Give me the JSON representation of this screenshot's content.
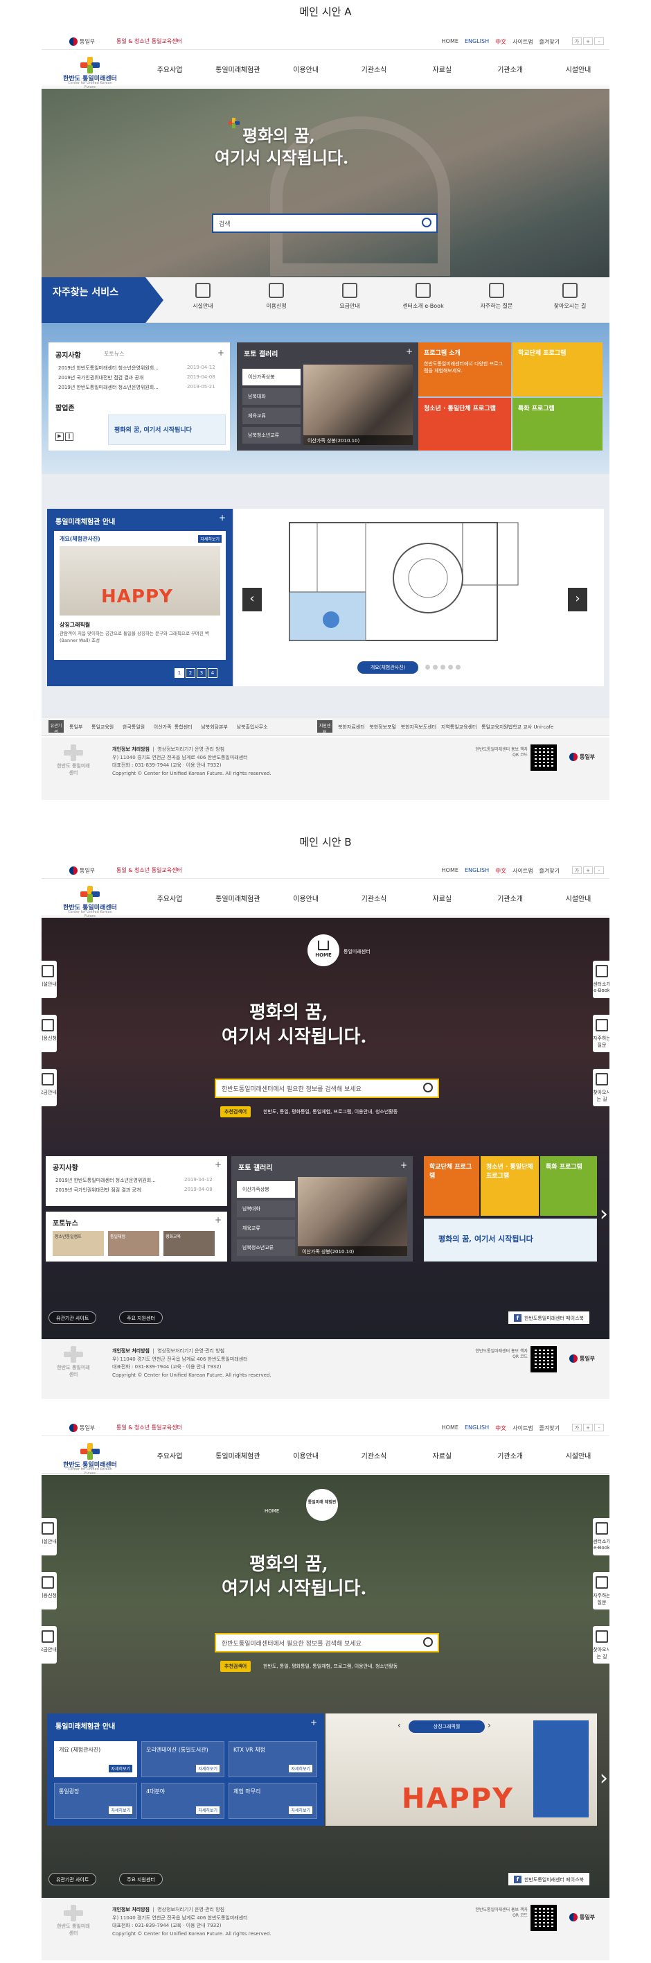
{
  "section_titles": {
    "a": "메인 시안 A",
    "b": "메인 시안 B"
  },
  "topbar": {
    "gov_label": "통일부",
    "partner_label": "통일 & 청소년 통일교육센터",
    "util": [
      "HOME",
      "ENGLISH",
      "中文",
      "사이트맵",
      "즐겨찾기"
    ],
    "font_sizes": [
      "가",
      "+",
      "-"
    ]
  },
  "logo": {
    "title": "한반도 통일미래센터",
    "subtitle": "Center for Unified Korean Future"
  },
  "menu": [
    "주요사업",
    "통일미래체험관",
    "이용안내",
    "기관소식",
    "자료실",
    "기관소개",
    "시설안내"
  ],
  "hero": {
    "slogan_line1": "평화의 꿈,",
    "slogan_line2": "여기서 시작됩니다.",
    "search_placeholder_a": "검색",
    "search_placeholder_b": "한반도통일미래센터에서 필요한 정보를 검색해 보세요",
    "recommend_label": "추천검색어",
    "recommend_terms": "한반도, 통일, 평화통일, 통일체험, 프로그램, 이용안내, 청소년활동"
  },
  "quick": {
    "title": "자주찾는 서비스",
    "items": [
      "시설안내",
      "이용신청",
      "요금안내",
      "센터소개 e-Book",
      "자주하는 질문",
      "찾아오시는 길"
    ]
  },
  "notice": {
    "tabs": [
      "공지사항",
      "포토뉴스"
    ],
    "items": [
      {
        "text": "2019년 한반도통일미래센터 청소년운영위원회...",
        "date": "2019-04-12"
      },
      {
        "text": "2019년 국가인권위대전만 점검 결과 공개",
        "date": "2019-04-08"
      },
      {
        "text": "2019년 한반도통일미래센터 청소년운영위원회...",
        "date": "2019-05-21"
      }
    ],
    "items_b": [
      {
        "text": "2019년 한반도통일미래센터 청소년운영위원회...",
        "date": "2019-04-12"
      },
      {
        "text": "2019년 국가인권위대전만 점검 결과 공개",
        "date": "2019-04-08"
      }
    ],
    "popup_title": "팝업존",
    "popup_banner": "평화의 꿈, 여기서 시작됩니다"
  },
  "photo_news": {
    "title": "포토뉴스",
    "captions": [
      "청소년통일캠프",
      "통일체험",
      "평화교육"
    ]
  },
  "gallery": {
    "title": "포토 갤러리",
    "items": [
      "이산가족상봉",
      "남북대화",
      "체육교류",
      "남북청소년교류"
    ],
    "caption": "이산가족 상봉(2010.10)"
  },
  "programs": {
    "intro_title": "프로그램 소개",
    "intro_text": "한반도통일미래센터에서 다양한 프로그램을 체험해보세요.",
    "tiles": [
      "학교단체 프로그램",
      "청소년 · 통일단체 프로그램",
      "특화 프로그램"
    ]
  },
  "exhibit": {
    "title": "통일미래체험관 안내",
    "tab": "개요(체험관사진)",
    "detail": "자세히보기",
    "photo_title": "상징그래픽월",
    "photo_desc": "관람객이 처음 맞이하는 공간으로 통일을 상징하는 문구와 그래픽으로 꾸며진 벽 (Banner Wall) 조성",
    "pages": [
      "1",
      "2",
      "3",
      "4"
    ],
    "map_button": "개요(체험관사진)",
    "cells": [
      "개요 (체험관사진)",
      "오리엔테이션 (통일도서관)",
      "KTX VR 체험",
      "통일광장",
      "4대분야",
      "체험 마무리"
    ]
  },
  "linkbar": {
    "label1": "유관기관",
    "links1": [
      "통일부",
      "통일교육원",
      "한국통일원",
      "이산가족 통합센터",
      "남북회담본부",
      "남북출입사무소"
    ],
    "label2": "지원센터",
    "links2": [
      "북한자료센터",
      "북한정보포털",
      "북한지적보도센터",
      "지역통일교육센터",
      "통일교육지원법학교 교사 Uni-cafe"
    ]
  },
  "footer": {
    "logo_text": "한반도 통일미래센터",
    "links": [
      "개인정보 처리방침",
      "영상정보처리기기 운영·관리 방침"
    ],
    "address": "우) 11040 경기도 연천군 전곡읍 남계로 406 한반도통일미래센터",
    "tel": "대표전화 : 031-839-7944 (교육 · 이용 안내 7932)",
    "copyright": "Copyright © Center for Unified Korean Future. All rights reserved.",
    "qr_label": "한반도통일미래센터 홍보 책자 QR 코드",
    "gov": "통일부"
  },
  "side_left": [
    "시설안내",
    "이용신청",
    "요금안내"
  ],
  "side_right": [
    "센터소개 e-Book",
    "자주하는 질문",
    "찾아오시는 길"
  ],
  "breadcrumb": {
    "home": "HOME",
    "current_b1": "통일미래센터",
    "current_b2": "통일미래 체험관"
  },
  "bottom_buttons": {
    "related": "유관기관 사이트",
    "main": "주요 지원센터",
    "facebook": "한반도통일미래센터 페이스북"
  },
  "colors": {
    "primary": "#1d4c9c",
    "orange": "#e8711c",
    "yellow": "#f2b81e",
    "green": "#7cb32e",
    "red": "#e74a2a"
  }
}
